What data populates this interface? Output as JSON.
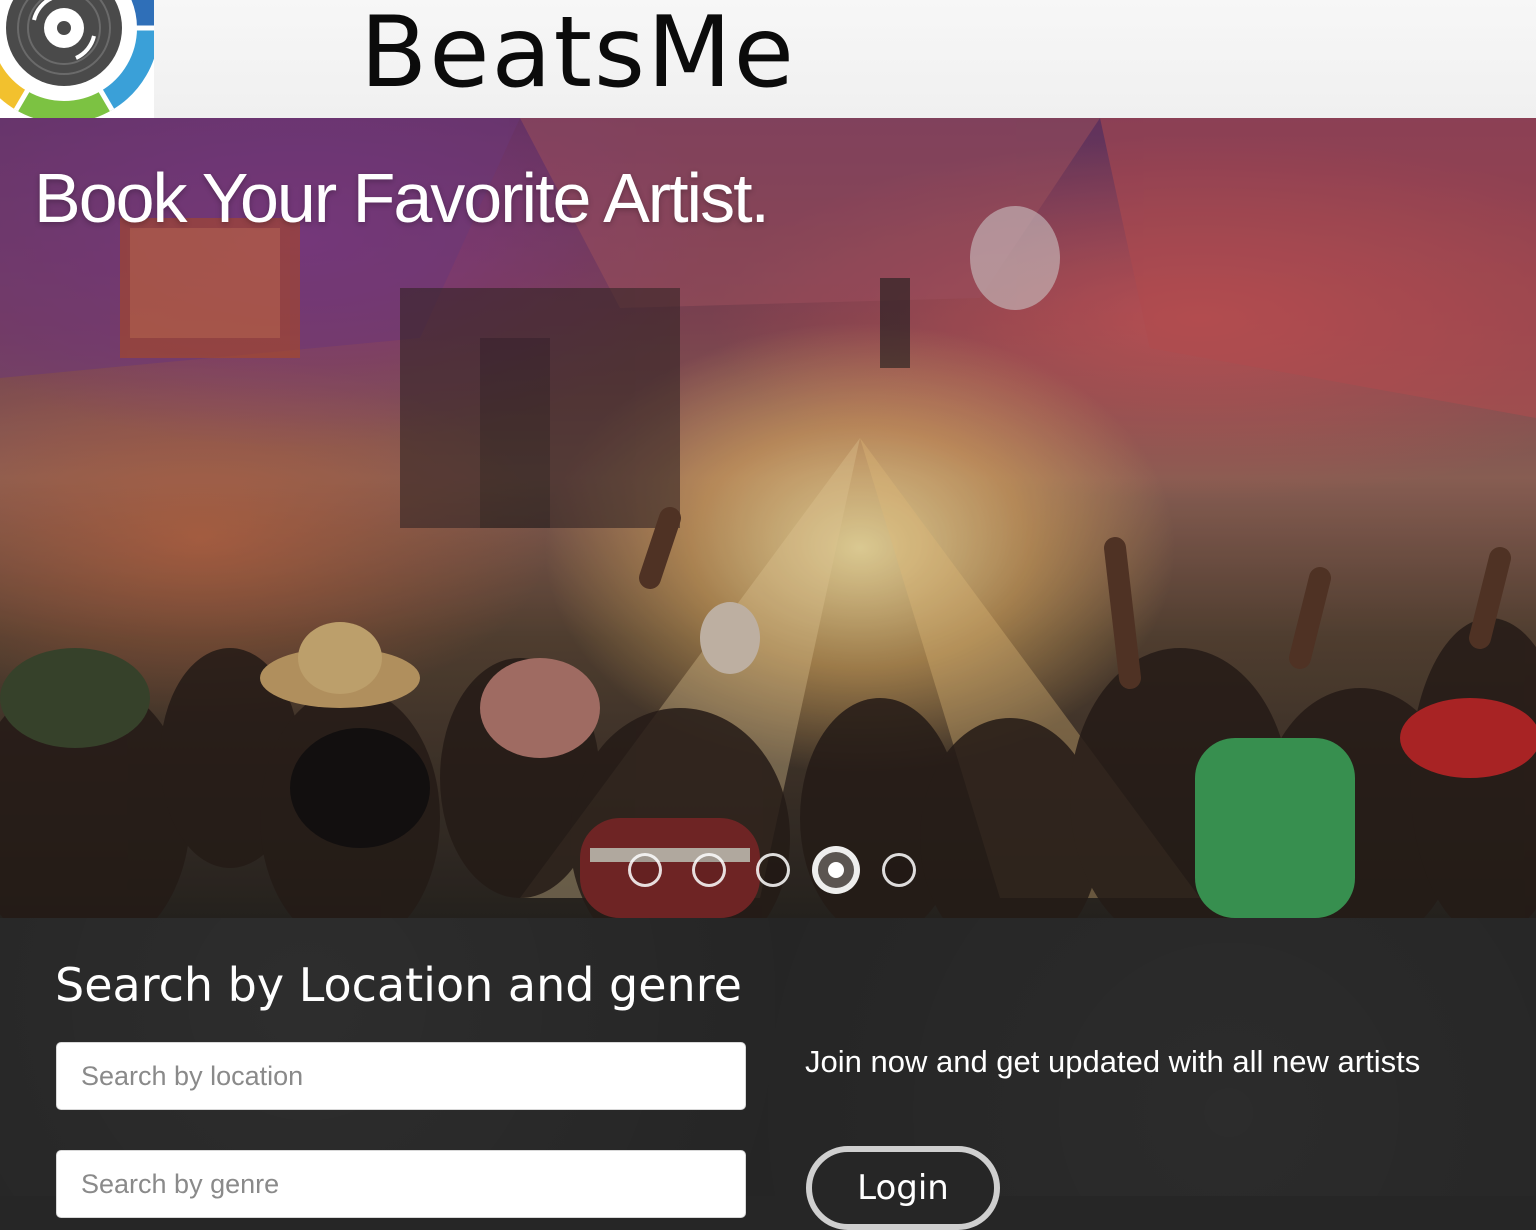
{
  "header": {
    "brand": "BeatsMe",
    "logo_icon": "vinyl-record-icon",
    "logo_ring_colors": [
      "#3aa0d8",
      "#7cc242",
      "#f2c12e",
      "#f08a24",
      "#e6462b",
      "#2f6fb8"
    ]
  },
  "hero": {
    "title": "Book Your Favorite Artist.",
    "carousel": {
      "slide_count": 5,
      "active_index": 3
    }
  },
  "search": {
    "heading": "Search by Location and genre",
    "location_placeholder": "Search by location",
    "genre_placeholder": "Search by genre"
  },
  "signup": {
    "text": "Join now and get updated with all new artists",
    "login_label": "Login"
  }
}
